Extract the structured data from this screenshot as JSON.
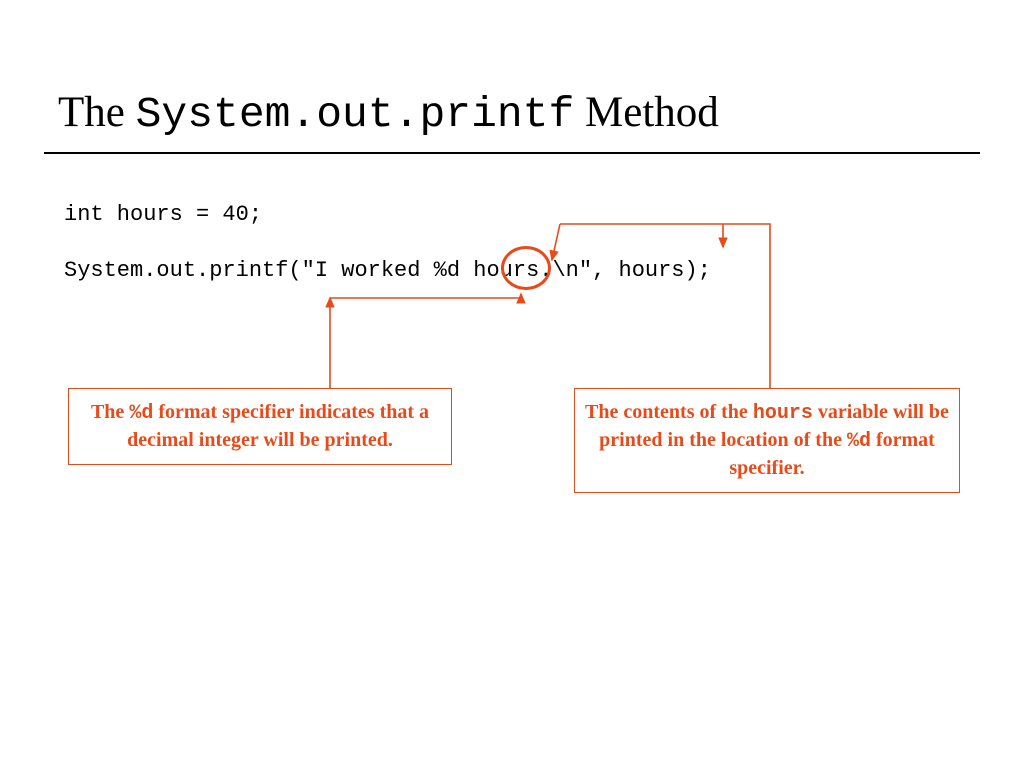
{
  "title": {
    "prefix": "The ",
    "mono": "System.out.printf",
    "suffix": " Method"
  },
  "code": {
    "line1": "int hours = 40;",
    "line2": "System.out.printf(\"I worked %d hours.\\n\", hours);"
  },
  "callouts": {
    "left": {
      "part1": "The ",
      "mono1": "%d",
      "part2": " format specifier indicates that a decimal integer will be printed."
    },
    "right": {
      "part1": "The contents of the ",
      "mono1": "hours",
      "part2": " variable will be printed in the location of the ",
      "mono2": "%d",
      "part3": " format specifier."
    }
  },
  "colors": {
    "accent": "#e84a1a"
  }
}
